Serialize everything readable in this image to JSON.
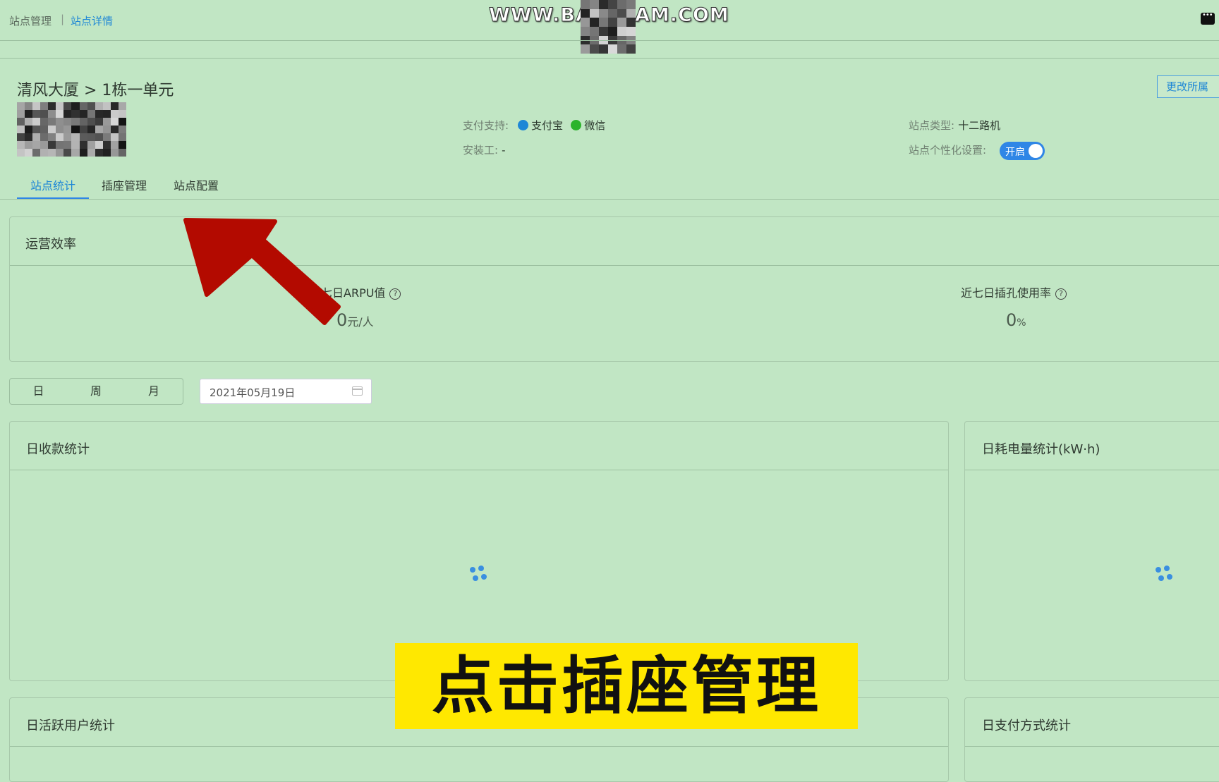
{
  "breadcrumb": {
    "parent": "站点管理",
    "separator": "|",
    "current": "站点详情"
  },
  "watermark": {
    "left_text": "WWW.BA",
    "right_text": "AM.COM"
  },
  "header": {
    "title": "清风大厦 > 1栋一单元",
    "change_button": "更改所属",
    "pay_label": "支付支持:",
    "pay_methods": [
      "支付宝",
      "微信"
    ],
    "installer_label": "安装工:",
    "installer_value": "-",
    "type_label": "站点类型:",
    "type_value": "十二路机",
    "custom_label": "站点个性化设置:",
    "custom_toggle": "开启"
  },
  "tabs": [
    "站点统计",
    "插座管理",
    "站点配置"
  ],
  "efficiency": {
    "title": "运营效率",
    "arpu_label": "近七日ARPU值",
    "arpu_value": "0",
    "arpu_unit": "元/人",
    "usage_label": "近七日插孔使用率",
    "usage_value": "0",
    "usage_unit": "%"
  },
  "period": {
    "options": [
      "日",
      "周",
      "月"
    ],
    "date": "2021年05月19日"
  },
  "charts": {
    "revenue_title": "日收款统计",
    "power_title": "日耗电量统计(kW·h)",
    "active_title": "日活跃用户统计",
    "payment_title": "日支付方式统计"
  },
  "caption": "点击插座管理",
  "colors": {
    "accent": "#1e87d6",
    "arrow": "#b30a00",
    "caption_bg": "#ffe800",
    "wechat": "#2bb32b",
    "alipay": "#1e87d6"
  }
}
